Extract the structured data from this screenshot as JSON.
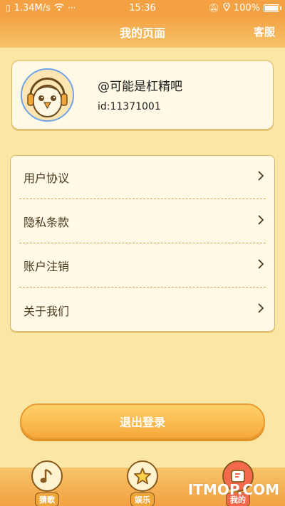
{
  "status_bar": {
    "network_speed": "1.34M/s",
    "time": "15:36",
    "battery": "100%"
  },
  "header": {
    "title": "我的页面",
    "service": "客服"
  },
  "profile": {
    "username": "@可能是杠精吧",
    "id": "id:11371001",
    "avatar_icon": "owl-headphones-avatar"
  },
  "menu": {
    "items": [
      {
        "label": "用户协议",
        "icon": "chevron-right-icon"
      },
      {
        "label": "隐私条款",
        "icon": "chevron-right-icon"
      },
      {
        "label": "账户注销",
        "icon": "chevron-right-icon"
      },
      {
        "label": "关于我们",
        "icon": "chevron-right-icon"
      }
    ]
  },
  "logout_label": "退出登录",
  "bottom_nav": {
    "items": [
      {
        "label": "猜歌",
        "icon": "music-note-icon",
        "active": false
      },
      {
        "label": "娱乐",
        "icon": "star-icon",
        "active": false
      },
      {
        "label": "我的",
        "icon": "profile-icon",
        "active": true
      }
    ]
  },
  "watermark": "ITMOP.COM",
  "colors": {
    "accent": "#f3a142",
    "background": "#fbe7a5",
    "card": "#fff9e6",
    "active_nav": "#f26a4b"
  }
}
